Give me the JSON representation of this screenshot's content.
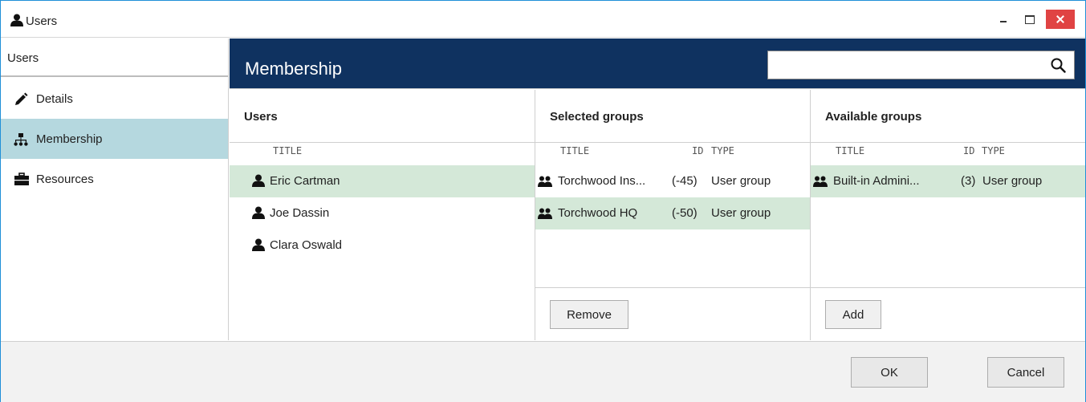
{
  "window": {
    "title": "Users",
    "icon": "user-icon",
    "controls": {
      "minimize": "minimize-icon",
      "maximize": "maximize-icon",
      "close": "close-icon",
      "close_color": "#e04343"
    }
  },
  "sidebar": {
    "heading": "Users",
    "items": [
      {
        "label": "Details",
        "icon": "pencil-icon"
      },
      {
        "label": "Membership",
        "icon": "hierarchy-icon",
        "active": true
      },
      {
        "label": "Resources",
        "icon": "briefcase-icon"
      }
    ],
    "active_color": "#b5d8df"
  },
  "header": {
    "title": "Membership",
    "background": "#0f3260",
    "search": {
      "value": "",
      "placeholder": "",
      "icon": "search-icon"
    }
  },
  "users_panel": {
    "title": "Users",
    "columns": [
      "TITLE"
    ],
    "rows": [
      {
        "title": "Eric Cartman",
        "selected": true,
        "icon": "user-icon"
      },
      {
        "title": "Joe Dassin",
        "selected": false,
        "icon": "user-icon"
      },
      {
        "title": "Clara Oswald",
        "selected": false,
        "icon": "user-icon"
      }
    ]
  },
  "selected_groups": {
    "title": "Selected groups",
    "columns": [
      "TITLE",
      "ID",
      "TYPE"
    ],
    "rows": [
      {
        "title": "Torchwood Ins...",
        "id": "(-45)",
        "type": "User group",
        "selected": false,
        "icon": "group-icon"
      },
      {
        "title": "Torchwood HQ",
        "id": "(-50)",
        "type": "User group",
        "selected": true,
        "icon": "group-icon"
      }
    ],
    "button": "Remove"
  },
  "available_groups": {
    "title": "Available groups",
    "columns": [
      "TITLE",
      "ID",
      "TYPE"
    ],
    "rows": [
      {
        "title": "Built-in Admini...",
        "id": "(3)",
        "type": "User group",
        "selected": true,
        "icon": "group-icon"
      }
    ],
    "button": "Add"
  },
  "footer": {
    "ok": "OK",
    "cancel": "Cancel"
  },
  "colors": {
    "selection": "#d4e8d8",
    "window_border": "#1f8fd8"
  }
}
